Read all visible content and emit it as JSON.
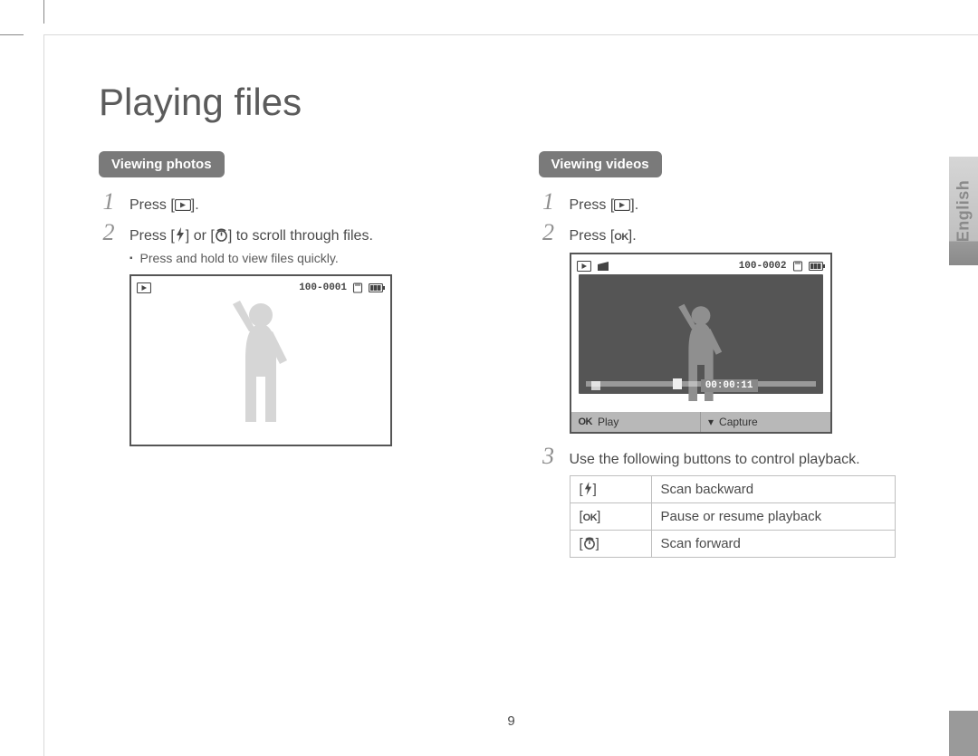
{
  "page": {
    "title": "Playing files",
    "number": "9",
    "language_tab": "English"
  },
  "left": {
    "heading": "Viewing photos",
    "steps": [
      {
        "n": "1",
        "text_pre": "Press [",
        "text_post": "].",
        "icon": "playback"
      },
      {
        "n": "2",
        "text_pre": "Press [",
        "mid1": "] or [",
        "text_post": "] to scroll through files.",
        "icon1": "flash",
        "icon2": "timer"
      }
    ],
    "bullet": "Press and hold to view files quickly.",
    "screen": {
      "file_label": "100-0001"
    }
  },
  "right": {
    "heading": "Viewing videos",
    "steps": [
      {
        "n": "1",
        "text_pre": "Press [",
        "text_post": "].",
        "icon": "playback"
      },
      {
        "n": "2",
        "text_pre": "Press [",
        "text_post": "].",
        "icon": "ok"
      }
    ],
    "screen": {
      "file_label": "100-0002",
      "time": "00:00:11",
      "footer_left": "Play",
      "footer_right": "Capture"
    },
    "step3": {
      "n": "3",
      "text": "Use the following buttons to control playback."
    },
    "table": [
      {
        "icon": "flash",
        "desc": "Scan backward"
      },
      {
        "icon": "ok",
        "desc": "Pause or resume playback"
      },
      {
        "icon": "timer",
        "desc": "Scan forward"
      }
    ]
  }
}
